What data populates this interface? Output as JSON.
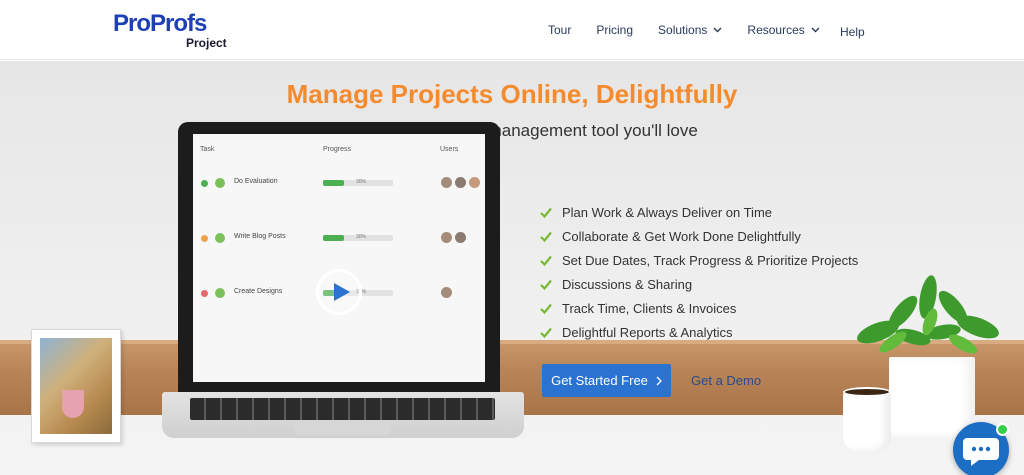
{
  "header": {
    "logo_main_a": "Pro",
    "logo_main_b": "Profs",
    "logo_sub": "Project",
    "nav": [
      {
        "label": "Tour"
      },
      {
        "label": "Pricing"
      },
      {
        "label": "Solutions"
      },
      {
        "label": "Resources"
      }
    ],
    "help": "Help"
  },
  "hero": {
    "title": "Manage Projects Online, Delightfully",
    "subtitle": "Easy to use online project management tool you'll love"
  },
  "screen": {
    "col_task": "Task",
    "col_progress": "Progress",
    "col_users": "Users",
    "tasks": [
      {
        "name": "Do Evaluation",
        "progress": "30%",
        "fill": 0.3,
        "dot_color": "#4caf50"
      },
      {
        "name": "Write Blog Posts",
        "progress": "30%",
        "fill": 0.3,
        "dot_color": "#f0a24a"
      },
      {
        "name": "Create Designs",
        "progress": "30%",
        "fill": 0.3,
        "dot_color": "#e26a6a"
      }
    ]
  },
  "features": [
    "Plan Work & Always Deliver on Time",
    "Collaborate & Get Work Done Delightfully",
    "Set Due Dates, Track Progress & Prioritize Projects",
    "Discussions & Sharing",
    "Track Time, Clients & Invoices",
    "Delightful Reports & Analytics"
  ],
  "cta": {
    "start": "Get Started Free",
    "demo": "Get a Demo"
  },
  "colors": {
    "brand": "#1f3fb5",
    "accent": "#f58b2f",
    "button": "#2b73d0",
    "check": "#7ab82f"
  },
  "icons": {
    "play": "play-icon",
    "chat": "chat-icon",
    "check": "check-icon",
    "chevron": "chevron-down-icon"
  }
}
